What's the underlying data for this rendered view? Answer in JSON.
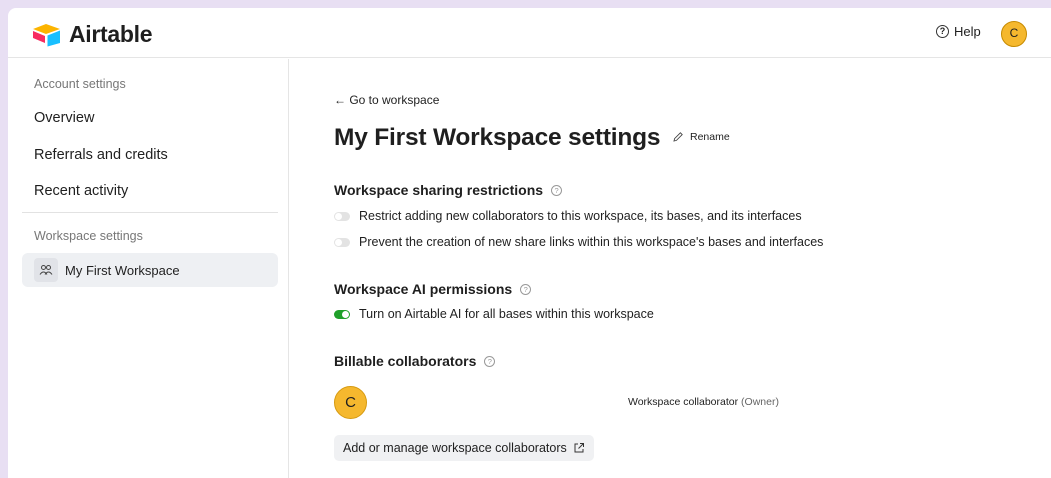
{
  "header": {
    "brand": "Airtable",
    "help_label": "Help",
    "avatar_initial": "C"
  },
  "sidebar": {
    "account_section": "Account settings",
    "items": [
      {
        "label": "Overview"
      },
      {
        "label": "Referrals and credits"
      },
      {
        "label": "Recent activity"
      }
    ],
    "workspace_section": "Workspace settings",
    "workspace_item": "My First Workspace"
  },
  "main": {
    "back_link": "← Go to workspace",
    "title": "My First Workspace settings",
    "rename_label": "Rename",
    "sharing": {
      "heading": "Workspace sharing restrictions",
      "toggles": [
        {
          "label": "Restrict adding new collaborators to this workspace, its bases, and its interfaces",
          "on": false
        },
        {
          "label": "Prevent the creation of new share links within this workspace's bases and interfaces",
          "on": false
        }
      ]
    },
    "ai": {
      "heading": "Workspace AI permissions",
      "toggle_label": "Turn on Airtable AI for all bases within this workspace",
      "on": true
    },
    "billable": {
      "heading": "Billable collaborators",
      "collaborator_initial": "C",
      "role": "Workspace collaborator",
      "role_note": "(Owner)",
      "manage_button": "Add or manage workspace collaborators"
    }
  },
  "colors": {
    "accent_green": "#20a02a",
    "avatar_yellow": "#f5b82e",
    "backdrop": "#e8dff3"
  }
}
